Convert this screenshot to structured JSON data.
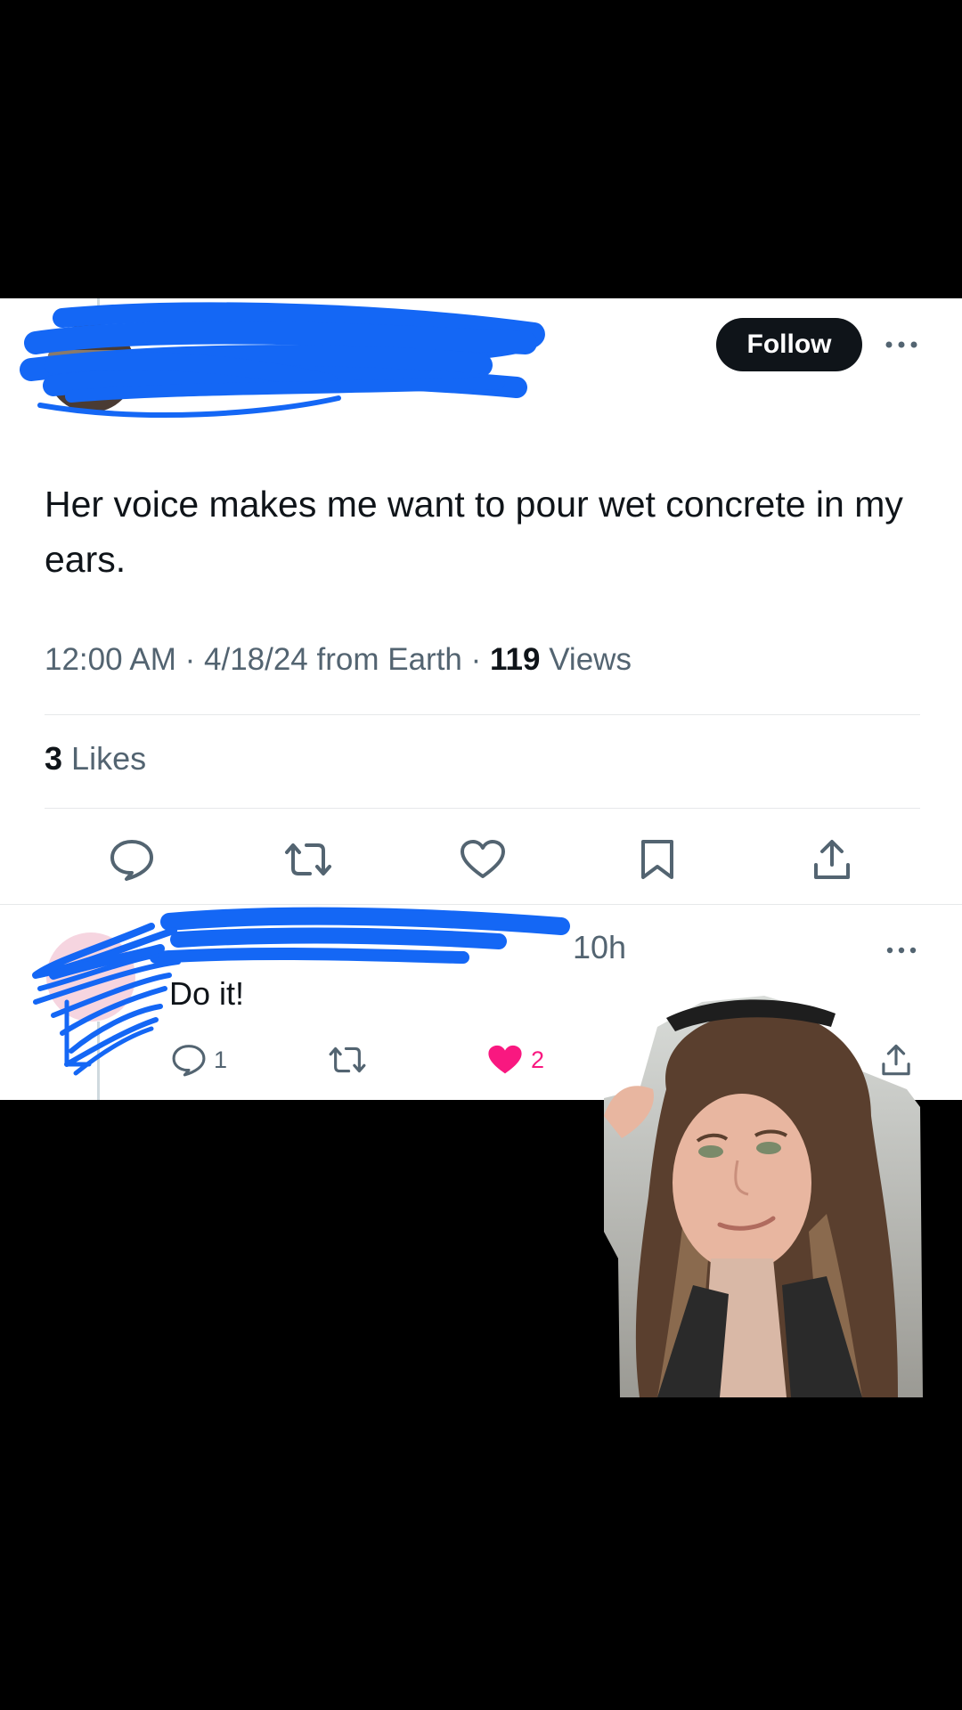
{
  "tweet": {
    "follow_label": "Follow",
    "text": "Her voice makes me want to pour wet concrete in my ears.",
    "time": "12:00 AM",
    "date": "4/18/24",
    "source": "from Earth",
    "views_count": "119",
    "views_label": "Views",
    "likes_count": "3",
    "likes_label": "Likes"
  },
  "reply": {
    "time": "10h",
    "text": "Do it!",
    "reply_count": "1",
    "like_count": "2"
  },
  "colors": {
    "text_primary": "#0f1419",
    "text_secondary": "#536471",
    "like_pink": "#f91880",
    "redaction_blue": "#1467f5"
  },
  "icons": [
    "more-icon",
    "reply-icon",
    "retweet-icon",
    "like-icon",
    "bookmark-icon",
    "share-icon"
  ]
}
